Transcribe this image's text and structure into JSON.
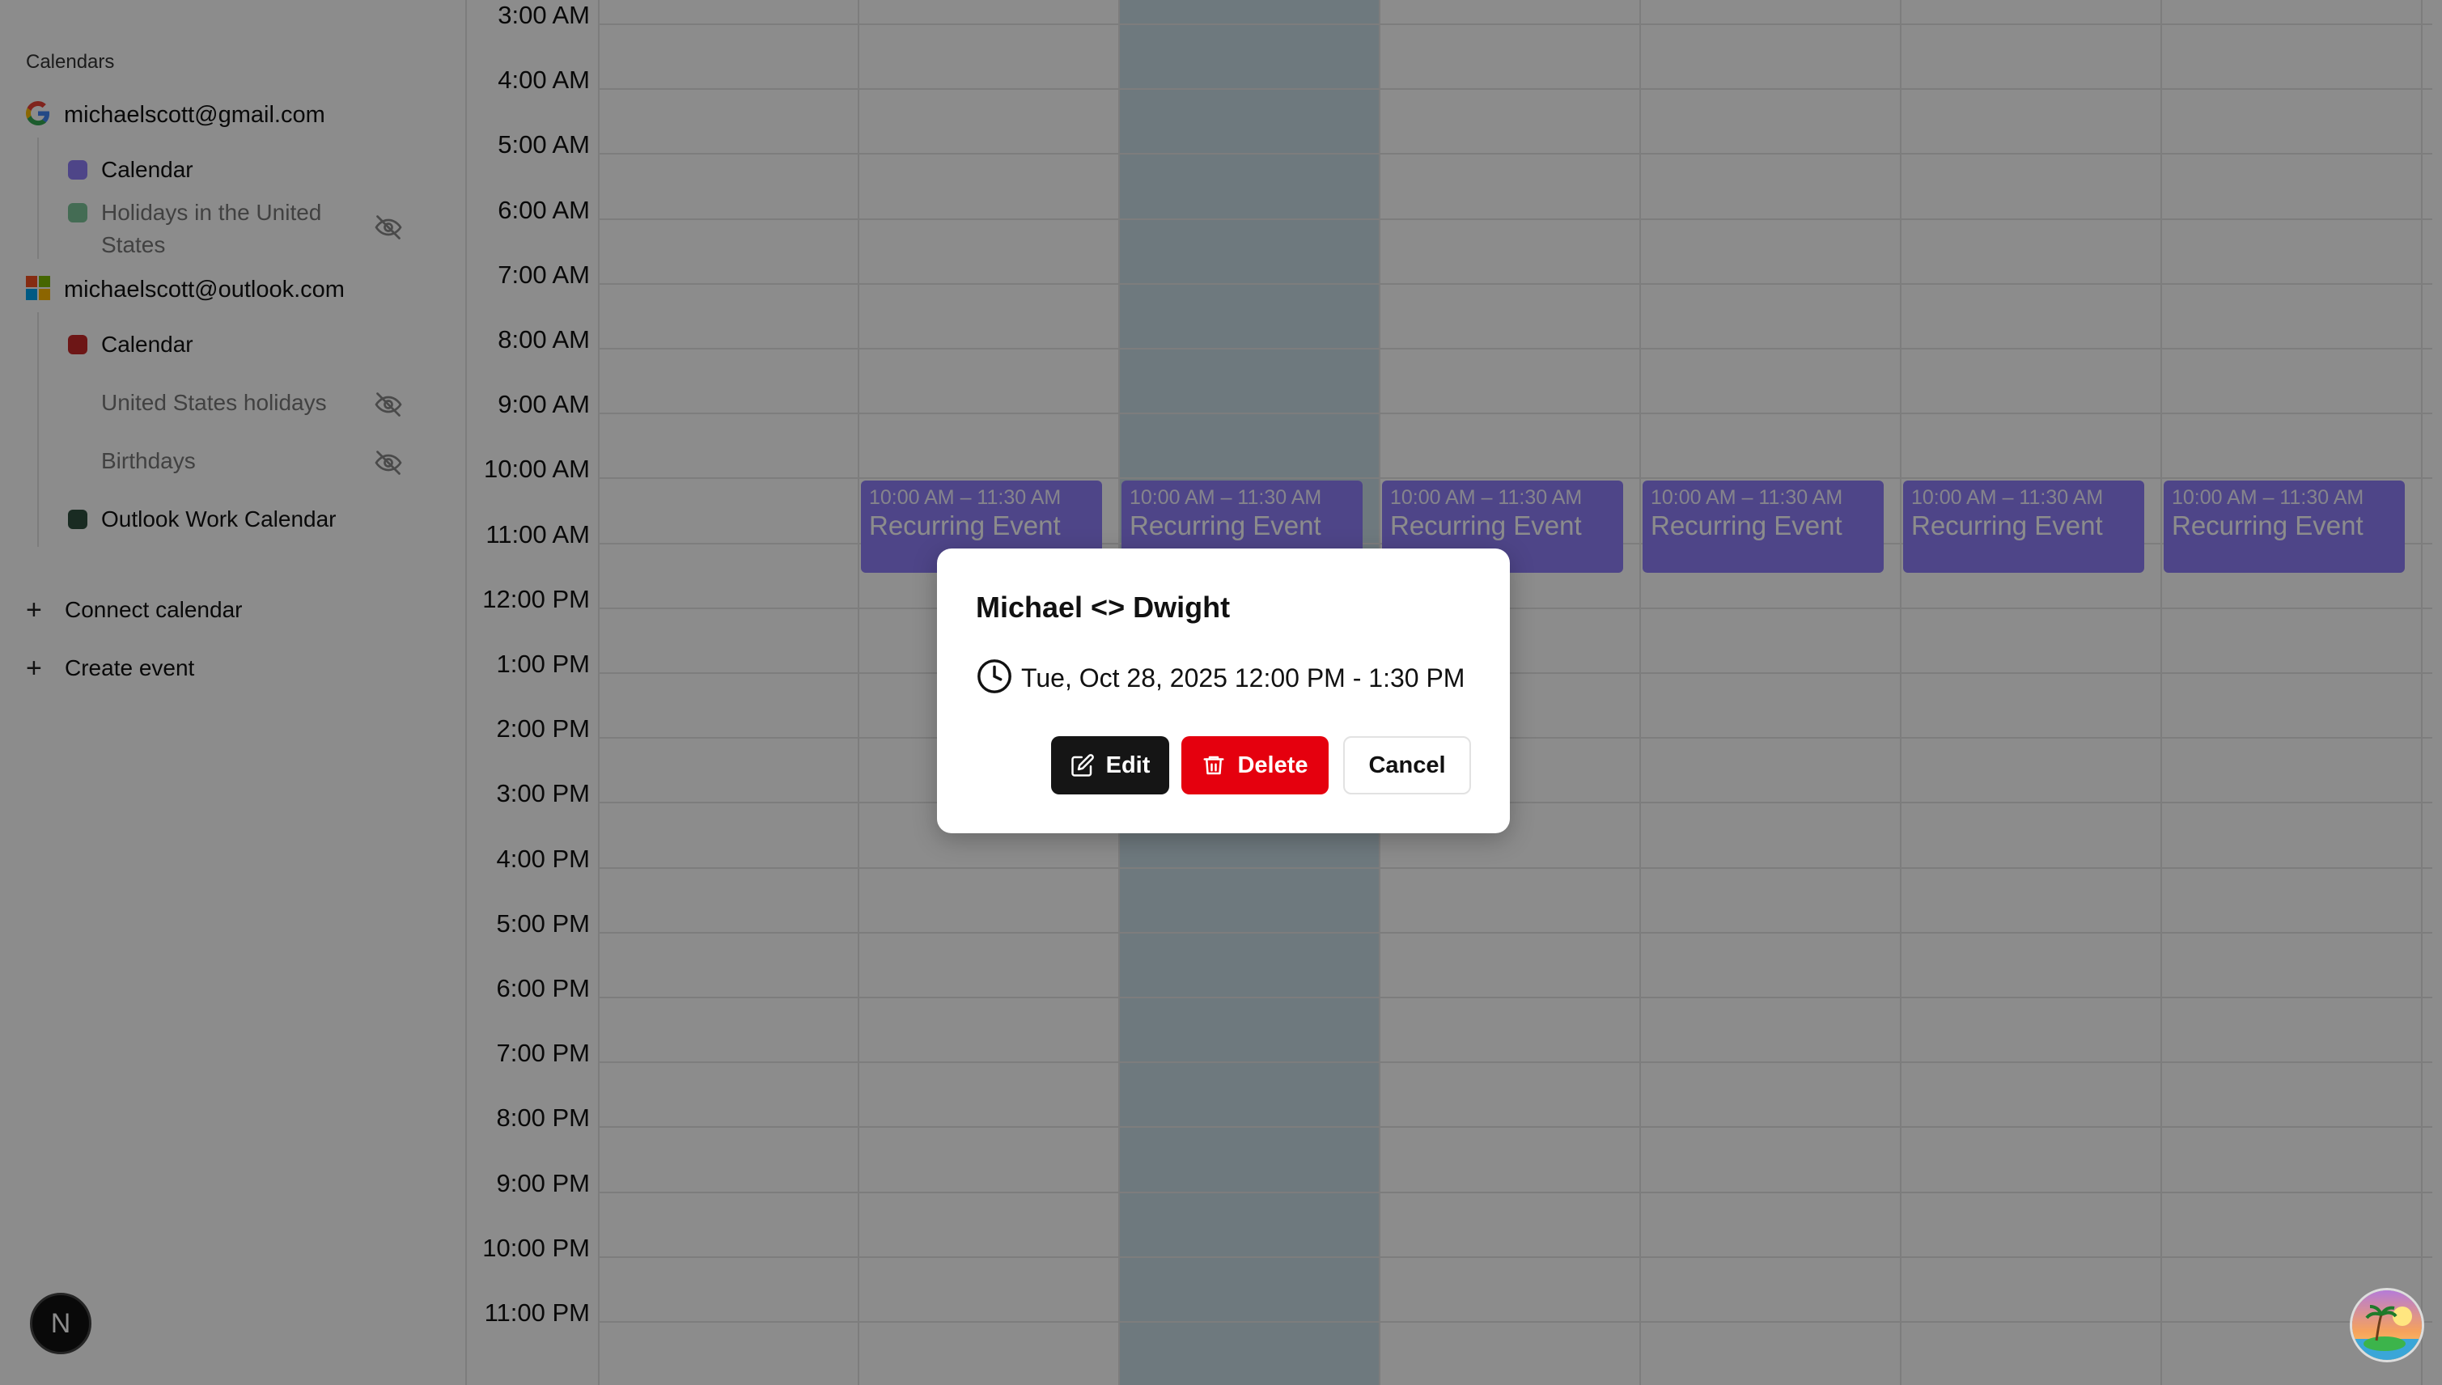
{
  "sidebar": {
    "heading": "Calendars",
    "accounts": [
      {
        "email": "michaelscott@gmail.com",
        "icon": "google-icon",
        "calendars": [
          {
            "label": "Calendar",
            "color": "#8f7ef7",
            "hidden": false
          },
          {
            "label": "Holidays in the United States",
            "color": "#7cc59a",
            "hidden": true
          }
        ]
      },
      {
        "email": "michaelscott@outlook.com",
        "icon": "microsoft-icon",
        "calendars": [
          {
            "label": "Calendar",
            "color": "#c62828",
            "hidden": false
          },
          {
            "label": "United States holidays",
            "color": null,
            "hidden": true
          },
          {
            "label": "Birthdays",
            "color": null,
            "hidden": true
          },
          {
            "label": "Outlook Work Calendar",
            "color": "#2f4f3f",
            "hidden": false
          }
        ]
      }
    ],
    "actions": {
      "connect": "Connect calendar",
      "create": "Create event"
    },
    "badge": "N"
  },
  "grid": {
    "hours": [
      "3:00 AM",
      "4:00 AM",
      "5:00 AM",
      "6:00 AM",
      "7:00 AM",
      "8:00 AM",
      "9:00 AM",
      "10:00 AM",
      "11:00 AM",
      "12:00 PM",
      "1:00 PM",
      "2:00 PM",
      "3:00 PM",
      "4:00 PM",
      "5:00 PM",
      "6:00 PM",
      "7:00 PM",
      "8:00 PM",
      "9:00 PM",
      "10:00 PM",
      "11:00 PM"
    ],
    "today_column": 3,
    "events": [
      {
        "day": 2,
        "time": "10:00 AM – 11:30 AM",
        "title": "Recurring Event"
      },
      {
        "day": 3,
        "time": "10:00 AM – 11:30 AM",
        "title": "Recurring Event"
      },
      {
        "day": 4,
        "time": "10:00 AM – 11:30 AM",
        "title": "Recurring Event"
      },
      {
        "day": 5,
        "time": "10:00 AM – 11:30 AM",
        "title": "Recurring Event"
      },
      {
        "day": 6,
        "time": "10:00 AM – 11:30 AM",
        "title": "Recurring Event"
      },
      {
        "day": 7,
        "time": "10:00 AM – 11:30 AM",
        "title": "Recurring Event"
      }
    ],
    "event_color": "#8f7ef7"
  },
  "modal": {
    "title": "Michael <> Dwight",
    "datetime": "Tue, Oct 28, 2025 12:00 PM - 1:30 PM",
    "edit_label": "Edit",
    "delete_label": "Delete",
    "cancel_label": "Cancel"
  },
  "colors": {
    "accent": "#8f7ef7",
    "delete": "#e5000e",
    "today_bg": "#c9dde5"
  }
}
